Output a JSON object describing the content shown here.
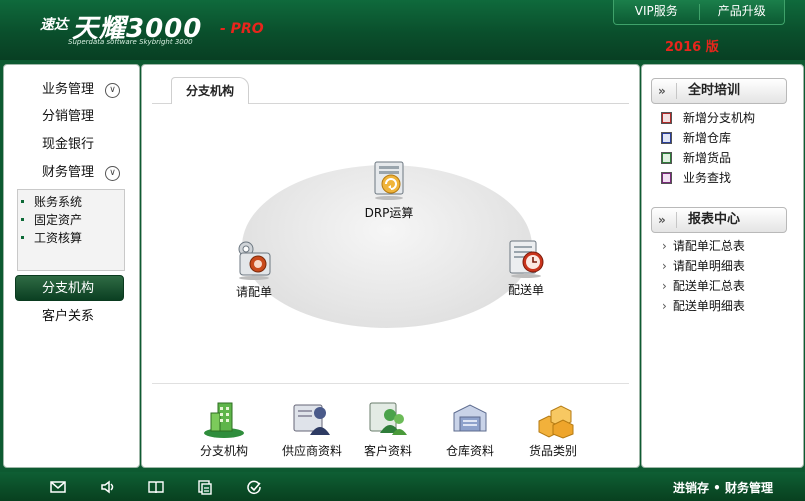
{
  "header": {
    "logo_prefix": "速达",
    "logo_name": "天耀3000",
    "logo_suffix": "- PRO",
    "logo_subtitle": "Superdata software Skybright 3000",
    "edition": "2016 版",
    "menu": [
      {
        "label": "VIP服务"
      },
      {
        "label": "产品升级"
      }
    ]
  },
  "sidebar": {
    "items": [
      {
        "label": "业务管理",
        "expandable": true
      },
      {
        "label": "分销管理"
      },
      {
        "label": "现金银行"
      },
      {
        "label": "财务管理",
        "expandable": true
      }
    ],
    "sub_items": [
      {
        "label": "账务系统"
      },
      {
        "label": "固定资产"
      },
      {
        "label": "工资核算"
      }
    ],
    "active_item": "分支机构",
    "after_items": [
      {
        "label": "客户关系"
      }
    ]
  },
  "main": {
    "tab_label": "分支机构",
    "flow": [
      {
        "label": "DRP运算",
        "icon": "drp-calc-icon"
      },
      {
        "label": "请配单",
        "icon": "request-order-icon"
      },
      {
        "label": "配送单",
        "icon": "delivery-order-icon"
      }
    ],
    "quick_links": [
      {
        "label": "分支机构",
        "icon": "branch-building-icon"
      },
      {
        "label": "供应商资料",
        "icon": "supplier-icon"
      },
      {
        "label": "客户资料",
        "icon": "customer-icon"
      },
      {
        "label": "仓库资料",
        "icon": "warehouse-icon"
      },
      {
        "label": "货品类别",
        "icon": "goods-category-icon"
      }
    ]
  },
  "right_panel": {
    "training": {
      "title": "全时培训",
      "items": [
        {
          "label": "新增分支机构",
          "color": "#b02a2a"
        },
        {
          "label": "新增仓库",
          "color": "#2a3f9a"
        },
        {
          "label": "新增货品",
          "color": "#2f7d3a"
        },
        {
          "label": "业务查找",
          "color": "#7a2a7a"
        }
      ]
    },
    "reports": {
      "title": "报表中心",
      "items": [
        {
          "label": "请配单汇总表"
        },
        {
          "label": "请配单明细表"
        },
        {
          "label": "配送单汇总表"
        },
        {
          "label": "配送单明细表"
        }
      ]
    }
  },
  "footer": {
    "icons": [
      "mail-icon",
      "speaker-icon",
      "book-icon",
      "copy-icon",
      "check-icon"
    ],
    "text": "进销存 • 财务管理"
  }
}
